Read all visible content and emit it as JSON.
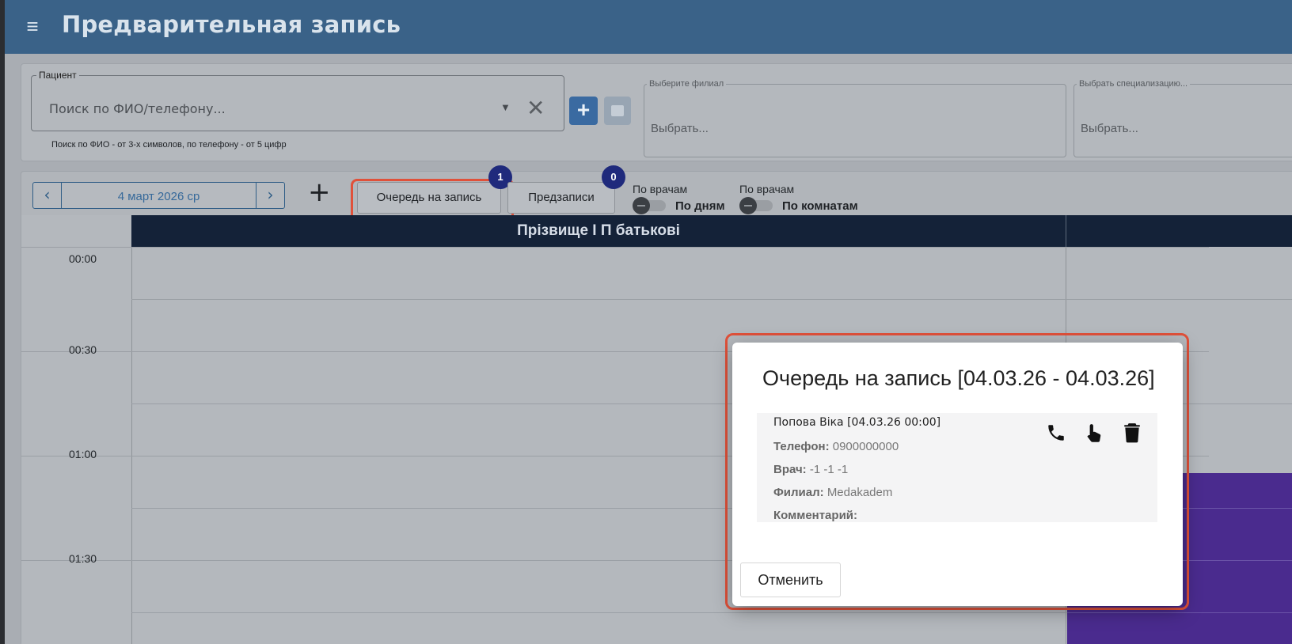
{
  "header": {
    "menu_icon": "hamburger-icon",
    "title": "Предварительная запись"
  },
  "filters": {
    "patient": {
      "legend": "Пациент",
      "placeholder": "Поиск по ФИО/телефону...",
      "hint": "Поиск по ФИО - от 3-х символов, по телефону - от 5 цифр"
    },
    "branch": {
      "legend": "Выберите филиал",
      "value": "Выбрать..."
    },
    "specialization": {
      "legend": "Выбрать специализацию...",
      "value": "Выбрать..."
    }
  },
  "toolbar": {
    "date": "4 март 2026 ср",
    "queue_label": "Очередь на запись",
    "queue_count": "1",
    "prebook_label": "Предзаписи",
    "prebook_count": "0",
    "toggle1": {
      "top": "По врачам",
      "bottom": "По дням"
    },
    "toggle2": {
      "top": "По врачам",
      "bottom": "По комнатам"
    }
  },
  "schedule": {
    "column_header": "Прізвище І П батькові",
    "times": [
      "00:00",
      "00:30",
      "01:00",
      "01:30"
    ]
  },
  "modal": {
    "title": "Очередь на запись [04.03.26 - 04.03.26]",
    "entry": {
      "name": "Попова Віка [04.03.26 00:00]",
      "phone_label": "Телефон:",
      "phone": "0900000000",
      "doctor_label": "Врач:",
      "doctor": "-1 -1 -1",
      "branch_label": "Филиал:",
      "branch": "Medakadem",
      "comment_label": "Комментарий:",
      "comment": ""
    },
    "cancel_label": "Отменить"
  },
  "colors": {
    "header": "#3a6288",
    "highlight": "#e0513a",
    "badge": "#1f2a7c",
    "event": "#4a2b8e"
  }
}
